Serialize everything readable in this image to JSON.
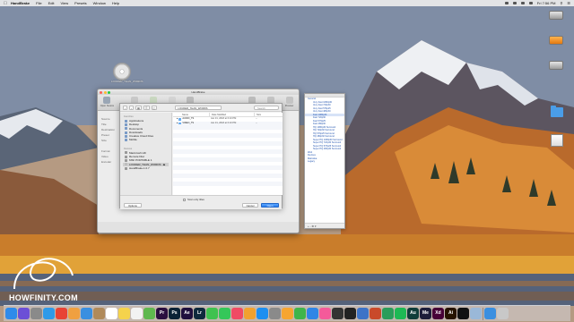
{
  "menubar": {
    "app_name": "HandBrake",
    "items": [
      "File",
      "Edit",
      "View",
      "Presets",
      "Window",
      "Help"
    ],
    "clock": "Fri 7:56 PM"
  },
  "desktop_icons": {
    "disc": "LOUDER_THAN_WORDS",
    "right_icons": [
      "",
      "",
      "",
      "",
      "",
      ""
    ]
  },
  "handbrake": {
    "title": "HandBrake",
    "toolbar": [
      "Open Source",
      "Add To Queue",
      "Start",
      "Pause",
      "Show Queue",
      "Presets",
      "Activity Log",
      "Preview"
    ],
    "sidebar_labels": [
      "Source",
      "Title",
      "Destination",
      "Preset",
      "Size",
      "Format",
      "Video",
      "Encoder"
    ]
  },
  "open_dialog": {
    "path": "LOUDER_THAN_WORDS",
    "search_placeholder": "Search",
    "favorites_header": "Favorites",
    "favorites": [
      "Applications",
      "Desktop",
      "Documents",
      "Downloads",
      "Creative Cloud Files",
      "Mobile"
    ],
    "devices_header": "Devices",
    "devices": [
      "Macintosh HD",
      "Remote Disc",
      "MSF PORTABLE 1",
      "LOUDER_THAN_WORDS",
      "HandBrake-1.0.7"
    ],
    "columns": [
      "Name",
      "Date Modified",
      "Size"
    ],
    "files": [
      {
        "name": "AUDIO_TS",
        "date": "Jan 31, 2018 at 6:10 PM",
        "size": "--"
      },
      {
        "name": "VIDEO_TS",
        "date": "Jan 31, 2018 at 6:10 PM",
        "size": "--"
      }
    ],
    "scan_label": "Scan only titles",
    "options_button": "Options",
    "cancel_button": "Cancel",
    "open_button": "Open"
  },
  "presets_panel": {
    "groups": [
      "General",
      "Web",
      "Devices",
      "Matroska",
      "Legacy"
    ],
    "general_presets": [
      "Very Fast 1080p30",
      "Very Fast 720p30",
      "Very Fast 576p25",
      "Very Fast 480p30",
      "Fast 1080p30",
      "Fast 720p30",
      "Fast 576p25",
      "Fast 480p30",
      "HQ 1080p30 Surround",
      "HQ 720p30 Surround",
      "HQ 576p25 Surround",
      "HQ 480p30 Surround",
      "Super HQ 1080p30 Surround",
      "Super HQ 720p30 Surround",
      "Super HQ 576p25 Surround",
      "Super HQ 480p30 Surround"
    ],
    "selected_index": 4,
    "bottom_controls": "+ -  ⚙ ▾"
  },
  "brand": {
    "text": "HOWFINITY.COM"
  },
  "dock": {
    "icons": [
      {
        "name": "finder",
        "color": "#2f8bea"
      },
      {
        "name": "siri",
        "color": "#6c4fd6"
      },
      {
        "name": "launchpad",
        "color": "#8a8a8a"
      },
      {
        "name": "safari",
        "color": "#2f9ae8"
      },
      {
        "name": "chrome",
        "color": "#e84335"
      },
      {
        "name": "photos",
        "color": "#f0a040"
      },
      {
        "name": "mail",
        "color": "#3a8fe0"
      },
      {
        "name": "contacts",
        "color": "#b08a5a"
      },
      {
        "name": "calendar",
        "color": "#ffffff"
      },
      {
        "name": "notes",
        "color": "#f5d34c"
      },
      {
        "name": "reminders",
        "color": "#f2f2f2"
      },
      {
        "name": "maps",
        "color": "#5fb84e"
      },
      {
        "name": "premiere",
        "color": "#2a0f3f"
      },
      {
        "name": "photoshop",
        "color": "#0b2236"
      },
      {
        "name": "after-effects",
        "color": "#1f0f3d"
      },
      {
        "name": "lightroom",
        "color": "#0f2a3d"
      },
      {
        "name": "messages",
        "color": "#3fc24f"
      },
      {
        "name": "facetime",
        "color": "#34c759"
      },
      {
        "name": "music",
        "color": "#f04b64"
      },
      {
        "name": "books",
        "color": "#f2a12e"
      },
      {
        "name": "app-store",
        "color": "#1e8ff0"
      },
      {
        "name": "system-preferences",
        "color": "#8a8a8a"
      },
      {
        "name": "pages",
        "color": "#f7a530"
      },
      {
        "name": "numbers",
        "color": "#3fb54a"
      },
      {
        "name": "keynote",
        "color": "#2f86e6"
      },
      {
        "name": "itunes",
        "color": "#f45a9a"
      },
      {
        "name": "davinci",
        "color": "#333333"
      },
      {
        "name": "obs",
        "color": "#222222"
      },
      {
        "name": "screenflow",
        "color": "#3d73c7"
      },
      {
        "name": "handbrake",
        "color": "#c94a2a"
      },
      {
        "name": "camtasia",
        "color": "#2a9d5a"
      },
      {
        "name": "spotify",
        "color": "#1db954"
      },
      {
        "name": "audition",
        "color": "#0f3d3a"
      },
      {
        "name": "media-encoder",
        "color": "#1d1d3a"
      },
      {
        "name": "xd",
        "color": "#470137"
      },
      {
        "name": "illustrator",
        "color": "#261300"
      },
      {
        "name": "terminal",
        "color": "#111111"
      },
      {
        "name": "preview",
        "color": "#9ab8d8"
      },
      {
        "name": "downloads",
        "color": "#3a8fe0"
      },
      {
        "name": "trash",
        "color": "#c8c8c8"
      }
    ],
    "labels": {
      "premiere": "Pr",
      "photoshop": "Ps",
      "after-effects": "Ae",
      "lightroom": "Lr",
      "audition": "Au",
      "media-encoder": "Me",
      "xd": "Xd",
      "illustrator": "Ai"
    }
  }
}
